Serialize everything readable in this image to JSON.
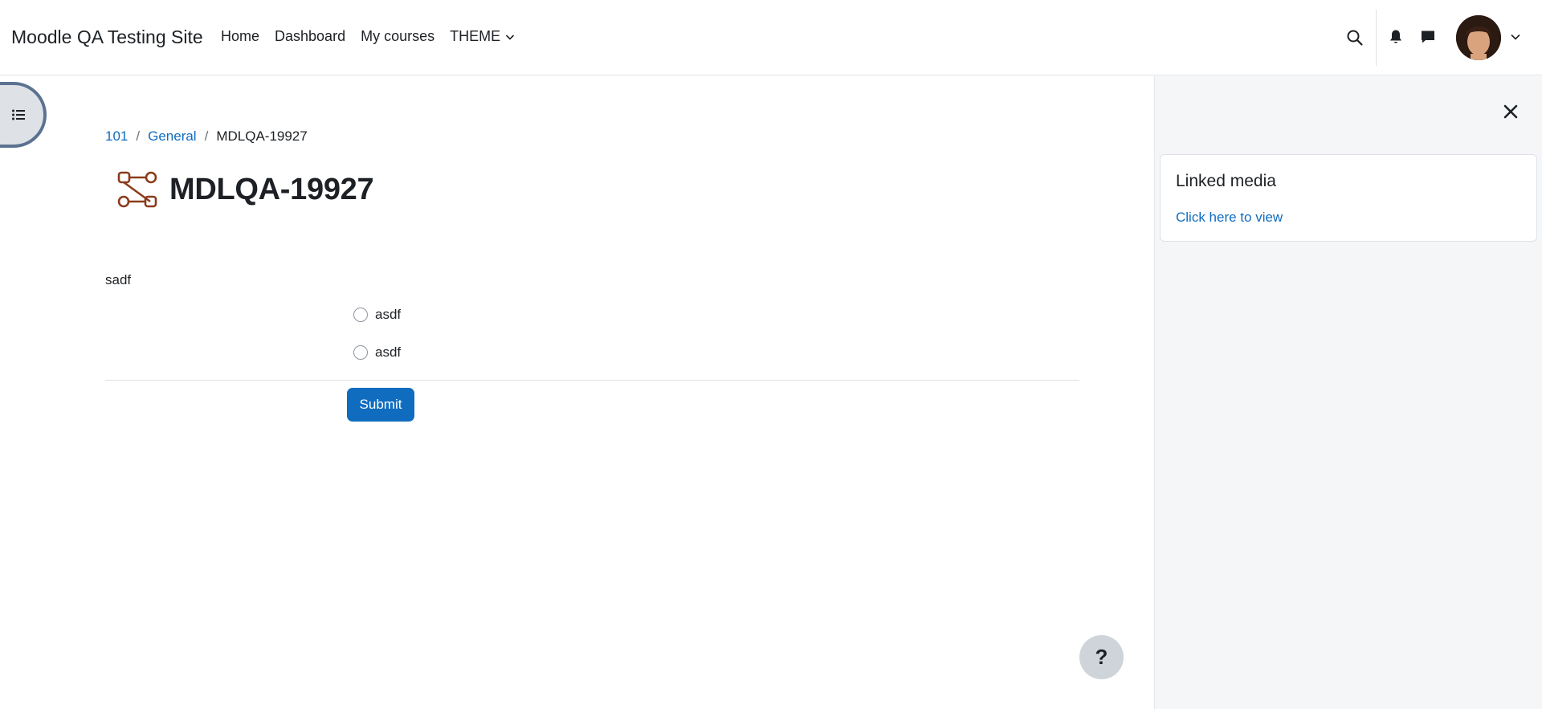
{
  "navbar": {
    "brand": "Moodle QA Testing Site",
    "links": [
      {
        "label": "Home"
      },
      {
        "label": "Dashboard"
      },
      {
        "label": "My courses"
      },
      {
        "label": "THEME"
      }
    ]
  },
  "breadcrumb": {
    "items": [
      "101",
      "General"
    ],
    "current": "MDLQA-19927",
    "separator": "/"
  },
  "page": {
    "title": "MDLQA-19927",
    "intro": "sadf",
    "options": [
      "asdf",
      "asdf"
    ],
    "submit_label": "Submit",
    "help_label": "?"
  },
  "right_drawer": {
    "block_title": "Linked media",
    "block_link": "Click here to view"
  },
  "colors": {
    "primary": "#0f6cbf",
    "activity_icon": "#8b3b1c",
    "drawer_bg": "#f5f6f8"
  }
}
